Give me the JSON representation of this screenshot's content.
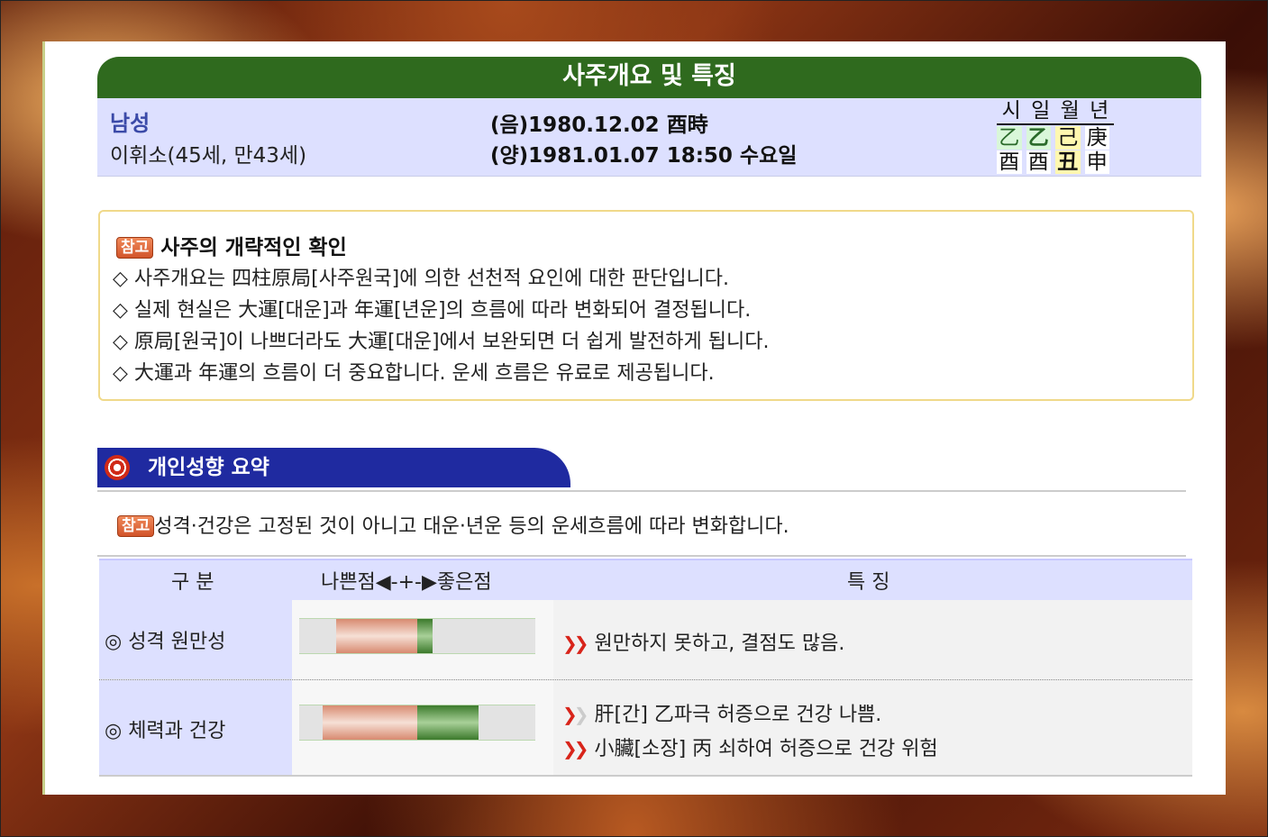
{
  "header": {
    "title": "사주개요 및 특징"
  },
  "person": {
    "gender": "남성",
    "name_age": "이휘소(45세, 만43세)",
    "lunar": "(음)1980.12.02 酉時",
    "solar": "(양)1981.01.07 18:50 수요일"
  },
  "pillars": {
    "labels": [
      "시",
      "일",
      "월",
      "년"
    ],
    "stems": [
      "乙",
      "乙",
      "己",
      "庚"
    ],
    "branches": [
      "酉",
      "酉",
      "丑",
      "申"
    ]
  },
  "note": {
    "badge": "참고",
    "title": "사주의 개략적인 확인",
    "lines": [
      "◇ 사주개요는 四柱原局[사주원국]에 의한 선천적 요인에 대한 판단입니다.",
      "◇ 실제 현실은 大運[대운]과 年運[년운]의 흐름에 따라 변화되어 결정됩니다.",
      "◇ 原局[원국]이 나쁘더라도 大運[대운]에서 보완되면 더 쉽게 발전하게 됩니다.",
      "◇ 大運과 年運의 흐름이 더 중요합니다. 운세 흐름은 유료로 제공됩니다."
    ]
  },
  "section": {
    "title": "개인성향 요약",
    "icon": "target-icon"
  },
  "summary": {
    "badge": "참고",
    "text": "성격·건강은 고정된 것이 아니고 대운·년운 등의 운세흐름에 따라 변화합니다."
  },
  "table": {
    "headers": [
      "구 분",
      "나쁜점◀-+-▶좋은점",
      "특 징"
    ],
    "rows": [
      {
        "category": "◎ 성격 원만성",
        "bad_start": 0.155,
        "bad_end": 0.5,
        "good_end": 0.565,
        "features": [
          "원만하지 못하고, 결점도 많음."
        ]
      },
      {
        "category": "◎ 체력과 건강",
        "bad_start": 0.1,
        "bad_end": 0.5,
        "good_end": 0.76,
        "features": [
          "肝[간] 乙파극 허증으로 건강 나쁨.",
          "小臟[소장] 丙 쇠하여 허증으로 건강 위험"
        ]
      }
    ]
  },
  "colors": {
    "header": "#2f6a1e",
    "section": "#1f2aa0",
    "info_bg": "#dde0ff",
    "accent": "#d8241a"
  }
}
